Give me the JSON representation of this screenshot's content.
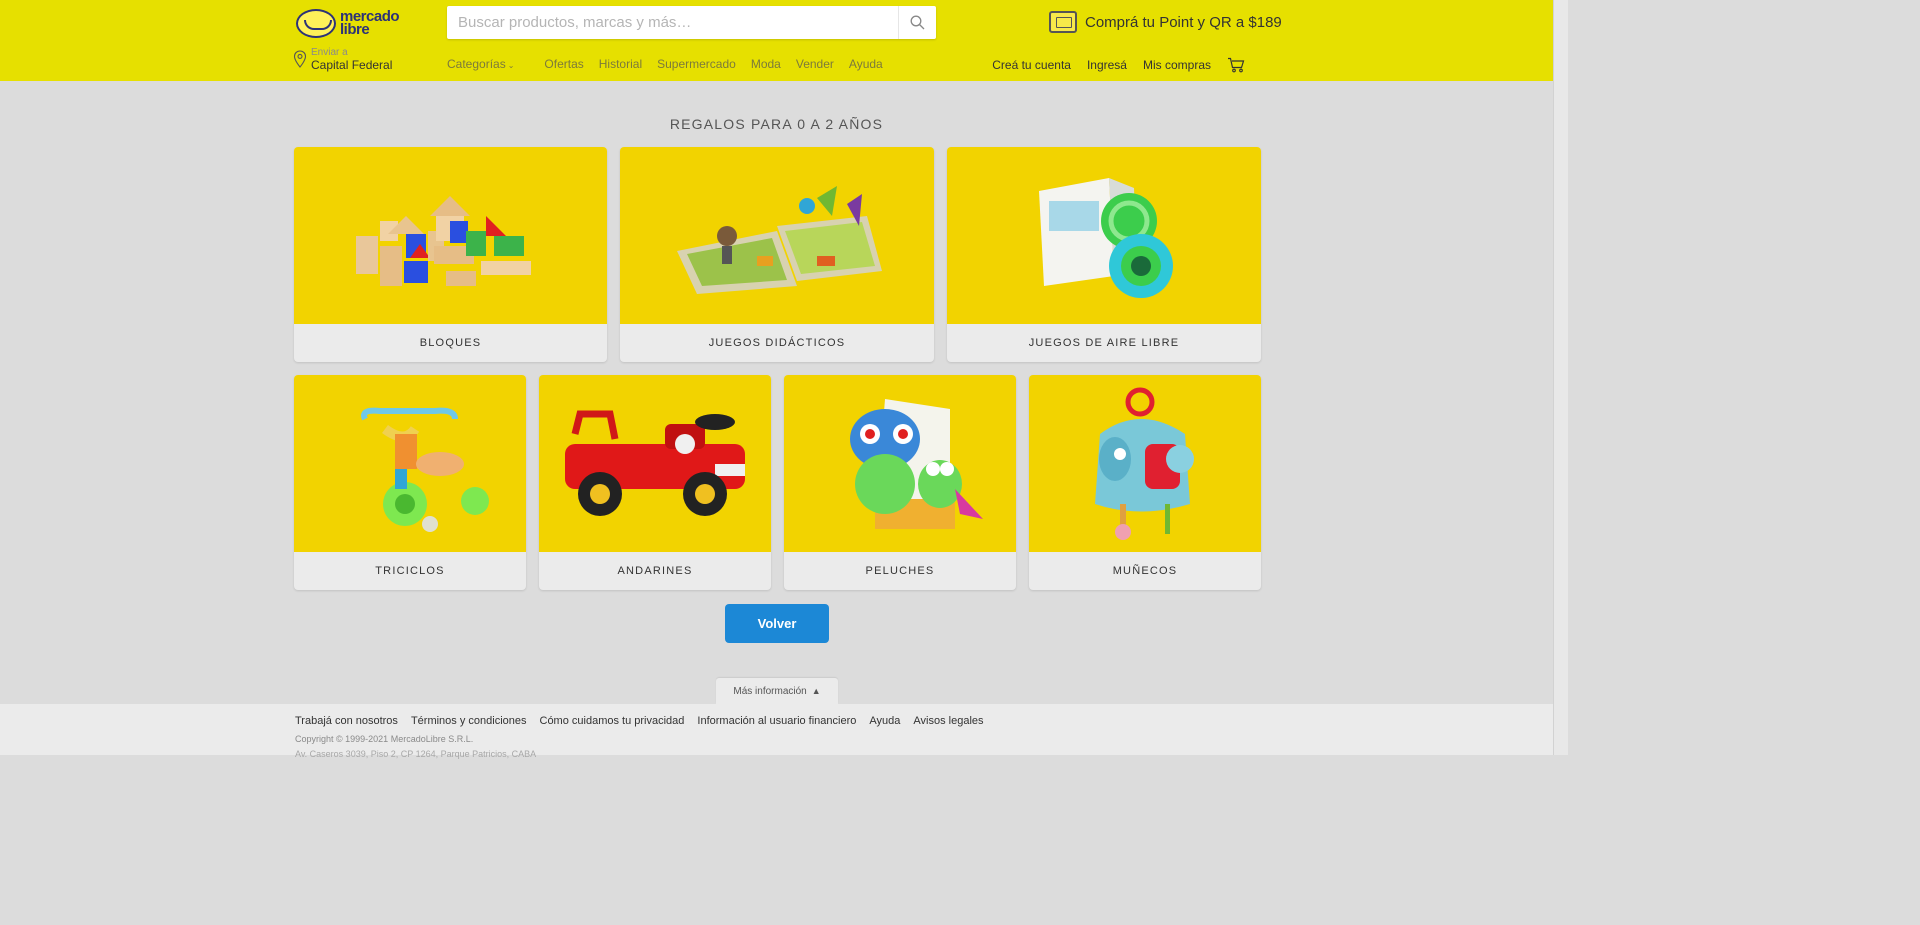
{
  "header": {
    "logo_line1": "mercado",
    "logo_line2": "libre",
    "search_placeholder": "Buscar productos, marcas y más…",
    "promo_text": "Comprá tu Point y QR a $189",
    "location_label": "Enviar a",
    "location_value": "Capital Federal",
    "nav": [
      "Categorías",
      "Ofertas",
      "Historial",
      "Supermercado",
      "Moda",
      "Vender",
      "Ayuda"
    ],
    "account": [
      "Creá tu cuenta",
      "Ingresá",
      "Mis compras"
    ],
    "colors": {
      "brand_yellow": "#e6e000",
      "brand_blue": "#2d3277"
    }
  },
  "main": {
    "title": "REGALOS PARA 0 A 2 AÑOS",
    "categories": [
      {
        "label": "BLOQUES",
        "icon": "blocks-image"
      },
      {
        "label": "JUEGOS DIDÁCTICOS",
        "icon": "puzzle-image"
      },
      {
        "label": "JUEGOS DE AIRE LIBRE",
        "icon": "ball-image"
      },
      {
        "label": "TRICICLOS",
        "icon": "tricycle-image"
      },
      {
        "label": "ANDARINES",
        "icon": "ride-on-car-image"
      },
      {
        "label": "PELUCHES",
        "icon": "plush-parrot-image"
      },
      {
        "label": "MUÑECOS",
        "icon": "elephant-toy-image"
      }
    ],
    "back_button": "Volver",
    "colors": {
      "card_bg": "#f2d300",
      "button": "#1c88d6"
    }
  },
  "footer": {
    "more_info": "Más información",
    "links": [
      "Trabajá con nosotros",
      "Términos y condiciones",
      "Cómo cuidamos tu privacidad",
      "Información al usuario financiero",
      "Ayuda",
      "Avisos legales"
    ],
    "copyright": "Copyright © 1999-2021 MercadoLibre S.R.L.",
    "address": "Av. Caseros 3039, Piso 2, CP 1264, Parque Patricios, CABA"
  }
}
